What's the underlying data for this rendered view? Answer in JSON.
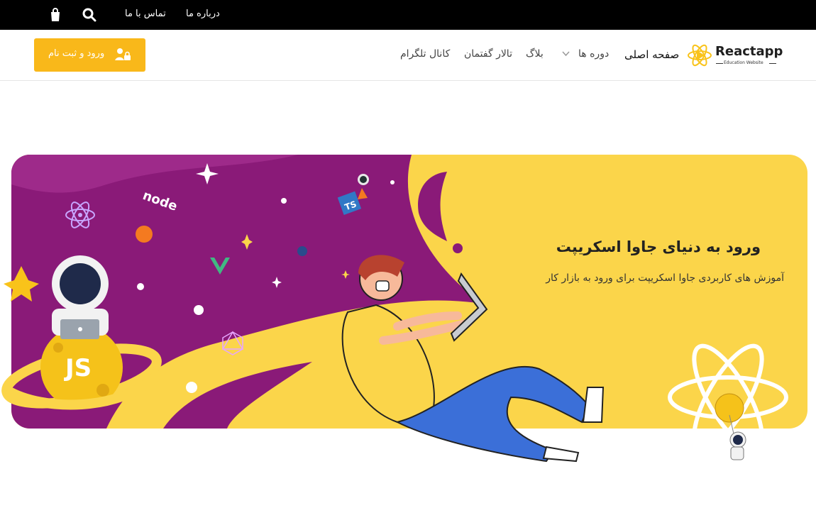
{
  "topbar": {
    "about": "درباره ما",
    "contact": "تماس با ما",
    "icons": [
      "search-icon",
      "shopping-bag-icon"
    ]
  },
  "logo": {
    "brand": "Reactapp",
    "tagline": "Education Website"
  },
  "nav": {
    "home": "صفحه اصلی",
    "courses": "دوره ها",
    "blog": "بلاگ",
    "forum": "تالار گفتمان",
    "telegram": "کانال تلگرام"
  },
  "cta": {
    "label": "ورود و ثبت نام",
    "icon": "user-lock-icon"
  },
  "hero": {
    "title": "ورود به دنیای جاوا اسکریپت",
    "subtitle": "آموزش های کاربردی جاوا اسکریپت برای ورود به بازار کار",
    "badges": {
      "js": "JS",
      "ts": "TS",
      "node": "node"
    }
  },
  "colors": {
    "accent": "#f9b81a",
    "purple": "#8a1a78",
    "yellow": "#fbd54a",
    "topbar": "#000000"
  }
}
